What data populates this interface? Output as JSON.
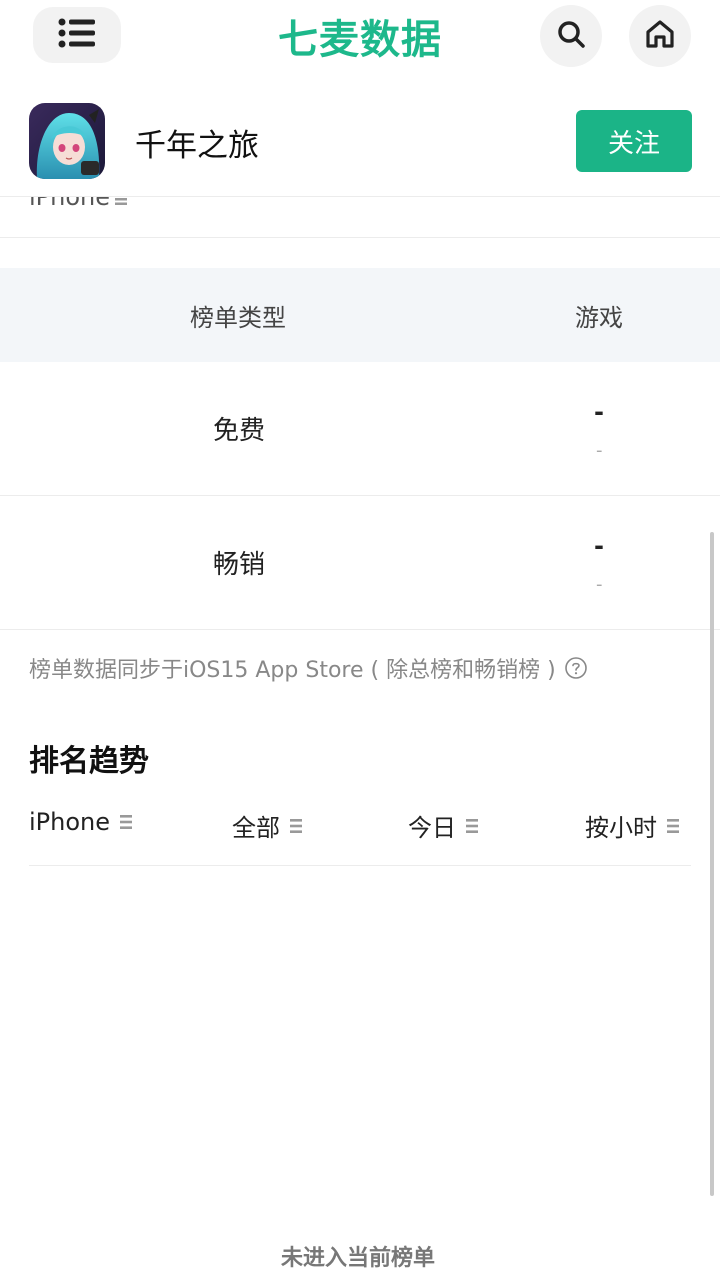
{
  "header": {
    "logo": "七麦数据",
    "menu_icon": "list-icon",
    "search_icon": "search-icon",
    "home_icon": "home-icon"
  },
  "app": {
    "name": "千年之旅",
    "follow_label": "关注"
  },
  "partial_row": {
    "device": "iPhone"
  },
  "rank_table": {
    "col_type": "榜单类型",
    "col_game": "游戏",
    "rows": [
      {
        "label": "免费",
        "rank": "-",
        "change": "-"
      },
      {
        "label": "畅销",
        "rank": "-",
        "change": "-"
      }
    ]
  },
  "note": "榜单数据同步于iOS15 App Store ( 除总榜和畅销榜 )",
  "trend": {
    "title": "排名趋势",
    "filters": [
      {
        "label": "iPhone"
      },
      {
        "label": "全部"
      },
      {
        "label": "今日"
      },
      {
        "label": "按小时"
      }
    ],
    "empty_text": "未进入当前榜单"
  },
  "colors": {
    "brand_green": "#1db88b",
    "button_green": "#1bb487",
    "table_head_bg": "#f3f6f9"
  }
}
